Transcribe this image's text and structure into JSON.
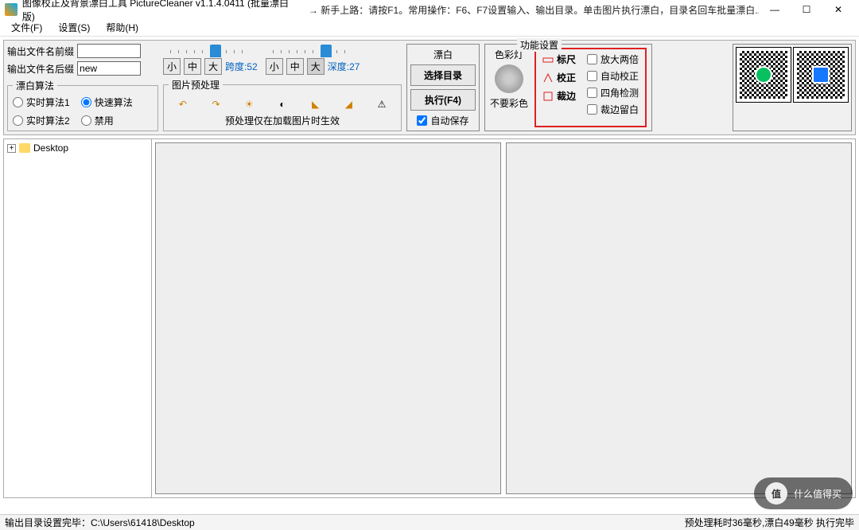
{
  "title": "图像校正及背景漂白工具 PictureCleaner v1.1.4.0411  (批量漂白版)",
  "hint": "→ 新手上路：请按F1。常用操作：F6、F7设置输入、输出目录。单击图片执行漂白，目录名回车批量漂白...",
  "wincontrols": {
    "min": "—",
    "max": "☐",
    "close": "✕"
  },
  "menu": {
    "file": "文件(F)",
    "settings": "设置(S)",
    "help": "帮助(H)"
  },
  "output": {
    "prefix_label": "输出文件名前缀",
    "prefix_value": "",
    "suffix_label": "输出文件名后缀",
    "suffix_value": "new"
  },
  "algo": {
    "legend": "漂白算法",
    "a1": "实时算法1",
    "a2": "实时算法2",
    "fast": "快速算法",
    "disable": "禁用"
  },
  "sliders": {
    "sizes": {
      "s": "小",
      "m": "中",
      "l": "大"
    },
    "span_label": "跨度:52",
    "depth_label": "深度:27"
  },
  "preproc": {
    "legend": "图片预处理",
    "note": "预处理仅在加载图片时生效"
  },
  "bleach": {
    "legend": "漂白",
    "select_dir": "选择目录",
    "execute": "执行(F4)",
    "autosave": "自动保存"
  },
  "feat": {
    "legend": "功能设置",
    "colorlight": "色彩灯",
    "nocolor": "不要彩色",
    "ruler": "标尺",
    "correct": "校正",
    "crop": "裁边",
    "enlarge": "放大两倍",
    "autocorrect": "自动校正",
    "fourcorner": "四角检测",
    "cropmargin": "裁边留白"
  },
  "tree": {
    "root": "Desktop"
  },
  "status": {
    "left": "输出目录设置完毕：C:\\Users\\61418\\Desktop",
    "right": "预处理耗时36毫秒,漂白49毫秒  执行完毕"
  },
  "watermark": {
    "char": "值",
    "text": "什么值得买"
  }
}
